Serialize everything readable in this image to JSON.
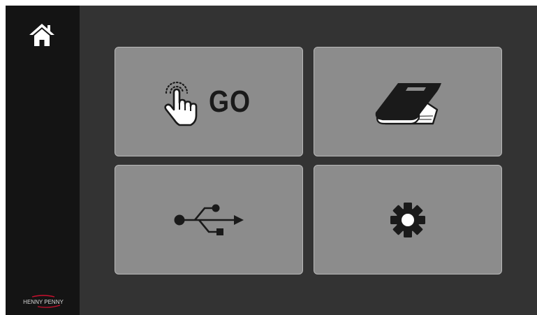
{
  "sidebar": {
    "home_icon": "home-icon",
    "logo_text": "HENNY PENNY"
  },
  "tiles": [
    {
      "id": "go",
      "icon": "tap-hand-icon",
      "label": "GO"
    },
    {
      "id": "manual",
      "icon": "book-icon"
    },
    {
      "id": "usb",
      "icon": "usb-icon"
    },
    {
      "id": "settings",
      "icon": "gear-icon"
    }
  ],
  "colors": {
    "screen_bg": "#333333",
    "sidebar_bg": "#141414",
    "tile_bg": "#8c8c8c",
    "tile_border": "#b9b9b9",
    "icon_dark": "#1a1a1a",
    "logo_accent": "#c8102e"
  }
}
